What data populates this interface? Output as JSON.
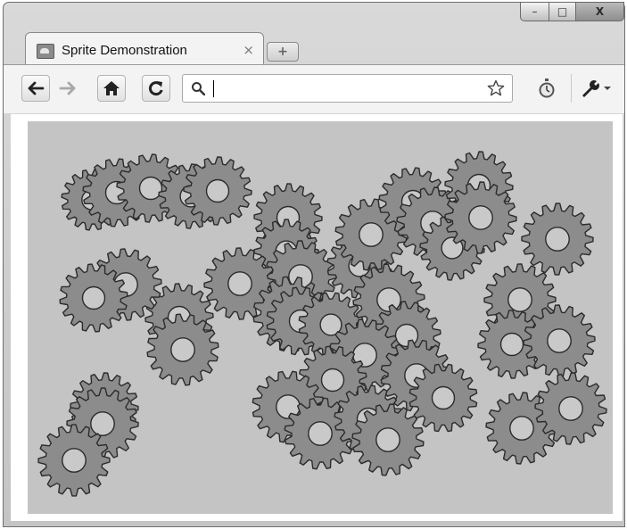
{
  "window": {
    "controls": {
      "minimize": "–",
      "maximize": "□",
      "close": "X"
    }
  },
  "tab": {
    "title": "Sprite Demonstration",
    "close": "×"
  },
  "new_tab": "+",
  "toolbar": {
    "back": "back-arrow-icon",
    "forward": "forward-arrow-icon",
    "home": "home-icon",
    "reload": "reload-icon",
    "address_value": "",
    "address_placeholder": "",
    "star": "star-icon",
    "extension": "stopwatch-icon",
    "wrench": "wrench-icon"
  },
  "stage": {
    "background": "#c4c4c4",
    "gear_fill": "#8c8c8c",
    "gear_stroke": "#2b2b2b",
    "hole_fill": "#c9c9c9",
    "gear_count": 41
  }
}
